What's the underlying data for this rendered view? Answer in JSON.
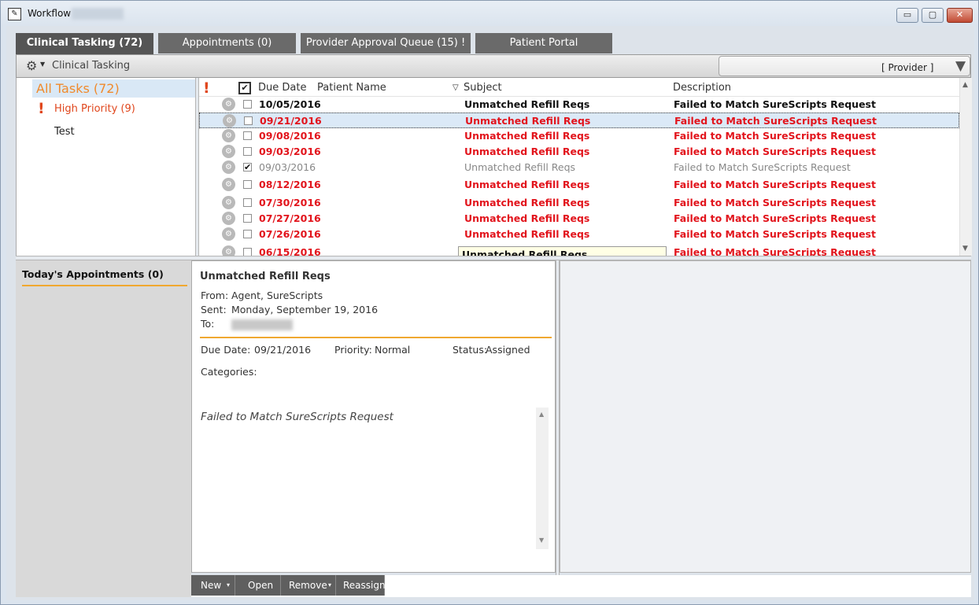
{
  "window": {
    "title": "Workflow"
  },
  "window_controls": {
    "minimize": "▭",
    "maximize": "▢",
    "close": "✕"
  },
  "tabs": [
    {
      "label": "Clinical Tasking (72)",
      "active": true
    },
    {
      "label": "Appointments (0)",
      "active": false
    },
    {
      "label": "Provider Approval Queue (15) !",
      "active": false
    },
    {
      "label": "Patient Portal",
      "active": false
    }
  ],
  "toolbar": {
    "title": "Clinical Tasking",
    "filter_value": "[ Provider ]",
    "gear_icon": "gear-icon",
    "filter_icon": "funnel-icon"
  },
  "sidebar": {
    "all_tasks": "All Tasks (72)",
    "high_priority": "High Priority (9)",
    "high_priority_icon": "!",
    "test": "Test"
  },
  "task_table": {
    "columns": {
      "priority_icon": "!",
      "complete_icon": "✔",
      "due_date": "Due Date",
      "patient_name": "Patient Name",
      "sort_icon": "▽",
      "subject": "Subject",
      "description": "Description"
    },
    "rows": [
      {
        "due": "10/05/2016",
        "checked": false,
        "subject": "Unmatched Refill Reqs",
        "description": "Failed to Match SureScripts Request",
        "style": "black"
      },
      {
        "due": "09/21/2016",
        "checked": false,
        "subject": "Unmatched Refill Reqs",
        "description": "Failed to Match SureScripts Request",
        "style": "red",
        "selected": true
      },
      {
        "due": "09/08/2016",
        "checked": false,
        "subject": "Unmatched Refill Reqs",
        "description": "Failed to Match SureScripts Request",
        "style": "red"
      },
      {
        "due": "09/03/2016",
        "checked": false,
        "subject": "Unmatched Refill Reqs",
        "description": "Failed to Match SureScripts Request",
        "style": "red"
      },
      {
        "due": "09/03/2016",
        "checked": true,
        "subject": "Unmatched Refill Reqs",
        "description": "Failed to Match SureScripts Request",
        "style": "gray"
      },
      {
        "due": "08/12/2016",
        "checked": false,
        "subject": "Unmatched Refill Reqs",
        "description": "Failed to Match SureScripts Request",
        "style": "red"
      },
      {
        "due": "07/30/2016",
        "checked": false,
        "subject": "Unmatched Refill Reqs",
        "description": "Failed to Match SureScripts Request",
        "style": "red"
      },
      {
        "due": "07/27/2016",
        "checked": false,
        "subject": "Unmatched Refill Reqs",
        "description": "Failed to Match SureScripts Request",
        "style": "red"
      },
      {
        "due": "07/26/2016",
        "checked": false,
        "subject": "Unmatched Refill Reqs",
        "description": "Failed to Match SureScripts Request",
        "style": "red"
      },
      {
        "due": "06/15/2016",
        "checked": false,
        "subject": "Unmatched Refill Reqs",
        "description": "Failed to Match SureScripts Request",
        "style": "red"
      }
    ],
    "tooltip": "Unmatched Refill Reqs"
  },
  "appointments": {
    "title": "Today's Appointments (0)"
  },
  "detail": {
    "subject": "Unmatched Refill Reqs",
    "from_label": "From:",
    "from_value": "Agent, SureScripts",
    "sent_label": "Sent:",
    "sent_value": "Monday, September 19, 2016",
    "to_label": "To:",
    "due_label": "Due Date:",
    "due_value": "09/21/2016",
    "priority_label": "Priority:",
    "priority_value": "Normal",
    "status_label": "Status:",
    "status_value": "Assigned",
    "categories_label": "Categories:",
    "body": "Failed to Match SureScripts Request"
  },
  "actions": {
    "new": "New",
    "open": "Open",
    "remove": "Remove",
    "reassign": "Reassign",
    "caret": "▾"
  },
  "colors": {
    "accent_orange": "#f08a2c",
    "priority_red": "#e2141c",
    "tab_gray": "#6a6a6a"
  }
}
